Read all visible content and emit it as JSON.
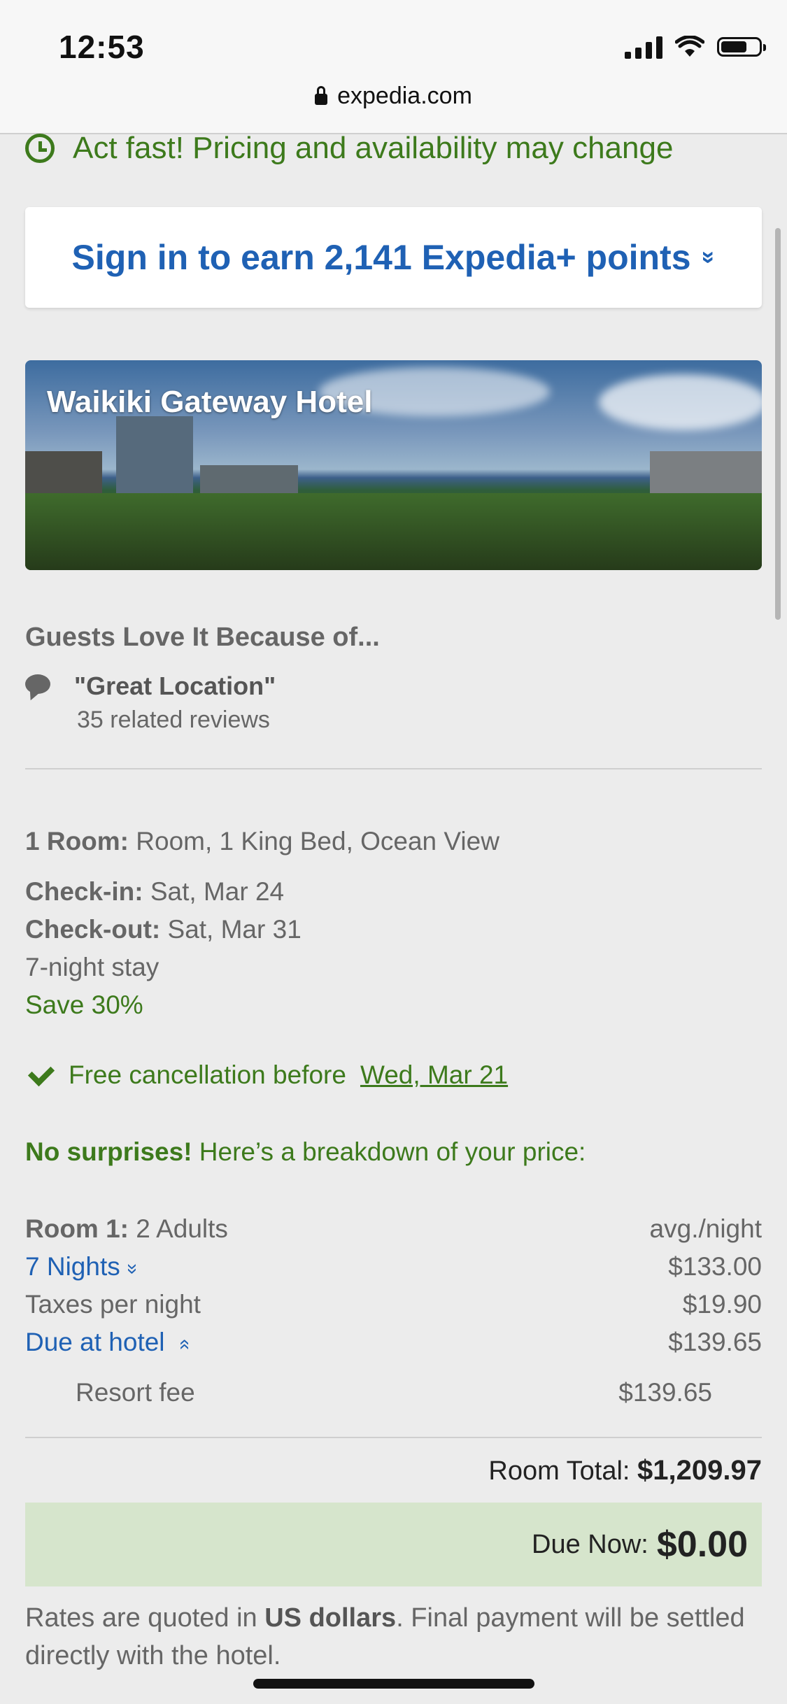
{
  "status_bar": {
    "time": "12:53"
  },
  "browser": {
    "url": "expedia.com"
  },
  "alert": {
    "text": "Act fast! Pricing and availability may change"
  },
  "signin": {
    "label": "Sign in to earn 2,141 Expedia+ points",
    "chevron": "»"
  },
  "hotel": {
    "name": "Waikiki Gateway Hotel"
  },
  "guests": {
    "title": "Guests Love It Because of...",
    "quote": "\"Great Location\"",
    "reviews": "35 related reviews"
  },
  "booking": {
    "room_label": "1 Room:",
    "room_value": "Room, 1 King Bed, Ocean View",
    "checkin_label": "Check-in:",
    "checkin_value": "Sat, Mar 24",
    "checkout_label": "Check-out:",
    "checkout_value": "Sat, Mar 31",
    "stay": "7-night stay",
    "save": "Save 30%"
  },
  "cancellation": {
    "text": "Free cancellation before",
    "date": "Wed, Mar 21"
  },
  "breakdown": {
    "headline_bold": "No surprises!",
    "headline_rest": "Here’s a breakdown of your price:",
    "room_label": "Room 1:",
    "room_value": "2 Adults",
    "avg_label": "avg./night",
    "nights_label": "7 Nights",
    "nights_chevron": "»",
    "nights_price": "$133.00",
    "taxes_label": "Taxes per night",
    "taxes_price": "$19.90",
    "due_hotel_label": "Due at hotel",
    "due_hotel_chevron": "»",
    "due_hotel_price": "$139.65",
    "resort_label": "Resort fee",
    "resort_price": "$139.65"
  },
  "totals": {
    "room_total_label": "Room Total:",
    "room_total_value": "$1,209.97",
    "due_now_label": "Due Now:",
    "due_now_value": "$0.00"
  },
  "rates_note": {
    "prefix": "Rates are quoted in",
    "bold": "US dollars",
    "suffix": ". Final payment will be settled directly with the hotel."
  },
  "colors": {
    "green": "#3d7a1c",
    "blue": "#1f61b4",
    "due_bg": "#d6e5cc"
  }
}
